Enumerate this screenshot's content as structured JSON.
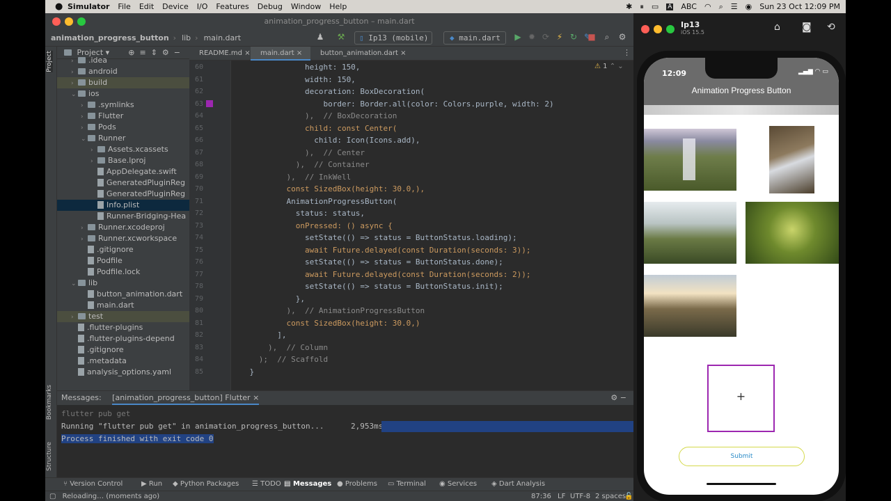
{
  "menubar": {
    "apple": "",
    "items": [
      "Simulator",
      "File",
      "Edit",
      "Device",
      "I/O",
      "Features",
      "Debug",
      "Window",
      "Help"
    ],
    "input_mode": "ABC",
    "datetime": "Sun 23 Oct  12:09 PM"
  },
  "ide": {
    "title": "animation_progress_button – main.dart",
    "breadcrumb": [
      "animation_progress_button",
      "lib",
      "main.dart"
    ],
    "device_selector": "Ip13 (mobile)",
    "run_config": "main.dart",
    "project_label": "Project",
    "tree": [
      {
        "label": ".idea",
        "indent": 1,
        "type": "folder",
        "chev": "›"
      },
      {
        "label": "android",
        "indent": 1,
        "type": "folder",
        "chev": "›"
      },
      {
        "label": "build",
        "indent": 1,
        "type": "folder",
        "chev": "›",
        "hl": true
      },
      {
        "label": "ios",
        "indent": 1,
        "type": "folder",
        "chev": "⌄"
      },
      {
        "label": ".symlinks",
        "indent": 2,
        "type": "folder",
        "chev": "›"
      },
      {
        "label": "Flutter",
        "indent": 2,
        "type": "folder",
        "chev": "›"
      },
      {
        "label": "Pods",
        "indent": 2,
        "type": "folder",
        "chev": "›"
      },
      {
        "label": "Runner",
        "indent": 2,
        "type": "folder",
        "chev": "⌄"
      },
      {
        "label": "Assets.xcassets",
        "indent": 3,
        "type": "folder",
        "chev": "›"
      },
      {
        "label": "Base.lproj",
        "indent": 3,
        "type": "folder",
        "chev": "›"
      },
      {
        "label": "AppDelegate.swift",
        "indent": 3,
        "type": "file"
      },
      {
        "label": "GeneratedPluginReg",
        "indent": 3,
        "type": "file"
      },
      {
        "label": "GeneratedPluginReg",
        "indent": 3,
        "type": "file"
      },
      {
        "label": "Info.plist",
        "indent": 3,
        "type": "file",
        "sel": true
      },
      {
        "label": "Runner-Bridging-Hea",
        "indent": 3,
        "type": "file"
      },
      {
        "label": "Runner.xcodeproj",
        "indent": 2,
        "type": "folder",
        "chev": "›"
      },
      {
        "label": "Runner.xcworkspace",
        "indent": 2,
        "type": "folder",
        "chev": "›"
      },
      {
        "label": ".gitignore",
        "indent": 2,
        "type": "file"
      },
      {
        "label": "Podfile",
        "indent": 2,
        "type": "file"
      },
      {
        "label": "Podfile.lock",
        "indent": 2,
        "type": "file"
      },
      {
        "label": "lib",
        "indent": 1,
        "type": "folder",
        "chev": "⌄"
      },
      {
        "label": "button_animation.dart",
        "indent": 2,
        "type": "file"
      },
      {
        "label": "main.dart",
        "indent": 2,
        "type": "file"
      },
      {
        "label": "test",
        "indent": 1,
        "type": "folder",
        "chev": "›",
        "hl": true
      },
      {
        "label": ".flutter-plugins",
        "indent": 1,
        "type": "file"
      },
      {
        "label": ".flutter-plugins-depend",
        "indent": 1,
        "type": "file"
      },
      {
        "label": ".gitignore",
        "indent": 1,
        "type": "file"
      },
      {
        "label": ".metadata",
        "indent": 1,
        "type": "file"
      },
      {
        "label": "analysis_options.yaml",
        "indent": 1,
        "type": "file"
      }
    ],
    "tabs": [
      "README.md",
      "main.dart",
      "button_animation.dart"
    ],
    "warnings": "1",
    "code_lines": [
      {
        "n": "60",
        "t": "                height: 150,"
      },
      {
        "n": "61",
        "t": "                width: 150,"
      },
      {
        "n": "62",
        "t": "                decoration: BoxDecoration("
      },
      {
        "n": "63",
        "t": "                    border: Border.all(color: Colors.purple, width: 2)"
      },
      {
        "n": "64",
        "t": "                ),  // BoxDecoration"
      },
      {
        "n": "65",
        "t": "                child: const Center("
      },
      {
        "n": "66",
        "t": "                  child: Icon(Icons.add),"
      },
      {
        "n": "67",
        "t": "                ),  // Center"
      },
      {
        "n": "68",
        "t": "              ),  // Container"
      },
      {
        "n": "69",
        "t": "            ),  // InkWell"
      },
      {
        "n": "70",
        "t": "            const SizedBox(height: 30.0,),"
      },
      {
        "n": "71",
        "t": "            AnimationProgressButton("
      },
      {
        "n": "72",
        "t": "              status: status,"
      },
      {
        "n": "73",
        "t": "              onPressed: () async {"
      },
      {
        "n": "74",
        "t": "                setState(() => status = ButtonStatus.loading);"
      },
      {
        "n": "75",
        "t": "                await Future.delayed(const Duration(seconds: 3));"
      },
      {
        "n": "76",
        "t": "                setState(() => status = ButtonStatus.done);"
      },
      {
        "n": "77",
        "t": "                await Future.delayed(const Duration(seconds: 2));"
      },
      {
        "n": "78",
        "t": "                setState(() => status = ButtonStatus.init);"
      },
      {
        "n": "79",
        "t": "              },"
      },
      {
        "n": "80",
        "t": "            ),  // AnimationProgressButton"
      },
      {
        "n": "81",
        "t": "            const SizedBox(height: 30.0,)"
      },
      {
        "n": "82",
        "t": "          ],"
      },
      {
        "n": "83",
        "t": "        ),  // Column"
      },
      {
        "n": "84",
        "t": "      );  // Scaffold"
      },
      {
        "n": "85",
        "t": "    }"
      }
    ],
    "messages": {
      "label": "Messages:",
      "tab": "[animation_progress_button] Flutter",
      "lines": [
        "flutter pub get",
        "Running \"flutter pub get\" in animation_progress_button...",
        "Process finished with exit code 0"
      ],
      "duration": "2,953ms"
    },
    "bottom_tabs": [
      "Version Control",
      "Run",
      "Python Packages",
      "TODO",
      "Messages",
      "Problems",
      "Terminal",
      "Services",
      "Dart Analysis"
    ],
    "status_left": "Reloading… (moments ago)",
    "status_right": [
      "87:36",
      "LF",
      "UTF-8",
      "2 spaces"
    ],
    "left_strip": [
      "Project",
      "Bookmarks",
      "Structure"
    ]
  },
  "simulator": {
    "device": "Ip13",
    "os": "iOS 15.5",
    "phone_time": "12:09",
    "app_title": "Animation Progress Button",
    "add_symbol": "+",
    "submit_label": "Submit",
    "accent_purple": "#9c27b0",
    "submit_border": "#d4d94a"
  }
}
